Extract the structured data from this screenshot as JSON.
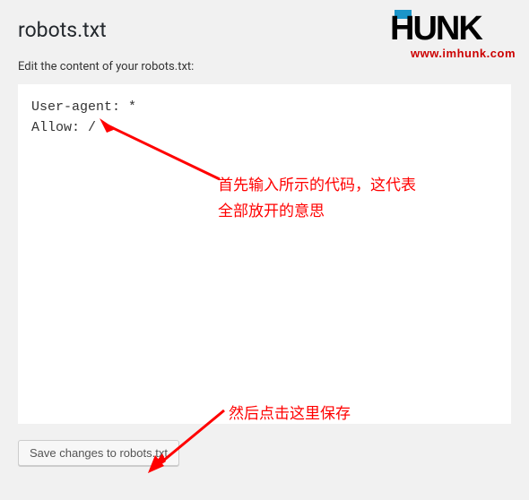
{
  "page": {
    "title": "robots.txt",
    "edit_label": "Edit the content of your robots.txt:"
  },
  "editor": {
    "content": "User-agent: *\nAllow: /"
  },
  "actions": {
    "save_label": "Save changes to robots.txt"
  },
  "logo": {
    "text": "HUNK",
    "url": "www.imhunk.com"
  },
  "annotations": {
    "first": "首先输入所示的代码，这代表\n全部放开的意思",
    "second": "然后点击这里保存"
  }
}
